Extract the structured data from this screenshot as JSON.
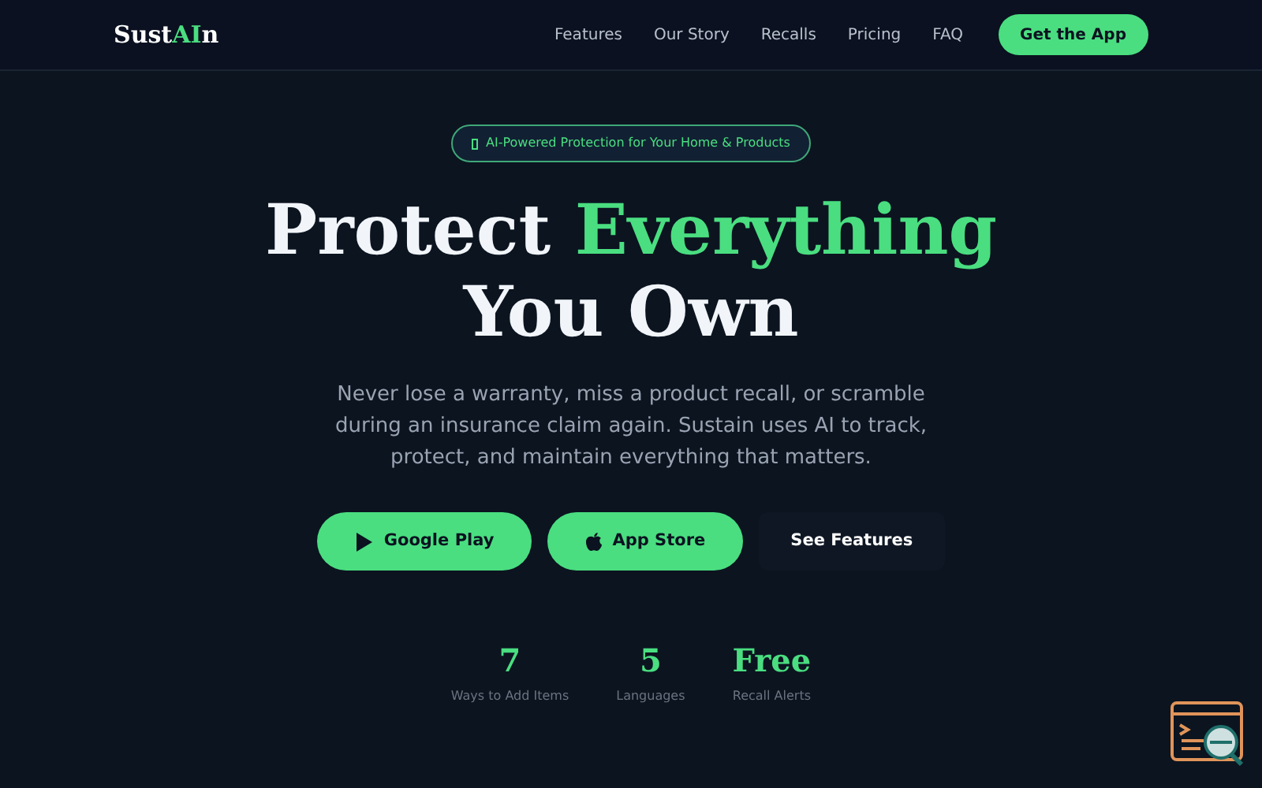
{
  "logo": [
    {
      "text": "Sust",
      "accent": false
    },
    {
      "text": "AI",
      "accent": true
    },
    {
      "text": "n",
      "accent": false
    }
  ],
  "nav": [
    "Features",
    "Our Story",
    "Recalls",
    "Pricing",
    "FAQ"
  ],
  "cta": "Get the App",
  "badge": "AI-Powered Protection for Your Home & Products",
  "headline": [
    {
      "text": "Protect ",
      "accent": false
    },
    {
      "text": "Everything",
      "accent": true
    },
    {
      "text": " You Own",
      "accent": false
    }
  ],
  "subtitle": "Never lose a warranty, miss a product recall, or scramble during an insurance claim again. Sustain uses AI to track, protect, and maintain everything that matters.",
  "buttons": [
    {
      "label": "Google Play",
      "kind": "play"
    },
    {
      "label": "App Store",
      "kind": "apple"
    },
    {
      "label": "See Features",
      "kind": "ghost"
    }
  ],
  "stats": [
    {
      "value": "7",
      "label": "Ways to Add Items"
    },
    {
      "value": "5",
      "label": "Languages"
    },
    {
      "value": "Free",
      "label": "Recall Alerts"
    }
  ]
}
